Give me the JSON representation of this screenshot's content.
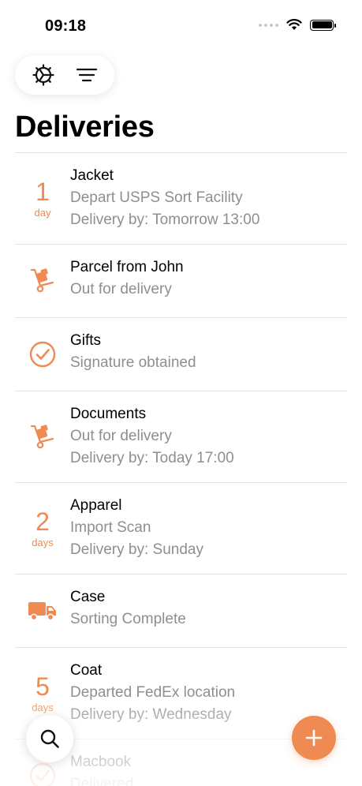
{
  "status_bar": {
    "time": "09:18"
  },
  "toolbar": {
    "settings_icon": "gear-icon",
    "filter_icon": "filter-lines-icon"
  },
  "page": {
    "title": "Deliveries"
  },
  "accent_color": "#ef8a52",
  "deliveries": [
    {
      "lead_type": "days",
      "lead_num": "1",
      "lead_unit": "day",
      "title": "Jacket",
      "status": "Depart USPS Sort Facility",
      "eta": "Delivery by: Tomorrow 13:00"
    },
    {
      "lead_type": "icon",
      "icon": "hand-truck-icon",
      "title": "Parcel from John",
      "status": "Out for delivery"
    },
    {
      "lead_type": "icon",
      "icon": "check-circle-icon",
      "title": "Gifts",
      "status": "Signature obtained"
    },
    {
      "lead_type": "icon",
      "icon": "hand-truck-icon",
      "title": "Documents",
      "status": "Out for delivery",
      "eta": "Delivery by: Today 17:00"
    },
    {
      "lead_type": "days",
      "lead_num": "2",
      "lead_unit": "days",
      "title": "Apparel",
      "status": "Import Scan",
      "eta": "Delivery by: Sunday"
    },
    {
      "lead_type": "icon",
      "icon": "truck-icon",
      "title": "Case",
      "status": "Sorting Complete"
    },
    {
      "lead_type": "days",
      "lead_num": "5",
      "lead_unit": "days",
      "title": "Coat",
      "status": "Departed FedEx location",
      "eta": "Delivery by: Wednesday"
    },
    {
      "lead_type": "icon",
      "icon": "check-circle-icon",
      "title": "Macbook",
      "status": "Delivered"
    }
  ],
  "fabs": {
    "search_icon": "search-icon",
    "add_icon": "plus-icon"
  }
}
